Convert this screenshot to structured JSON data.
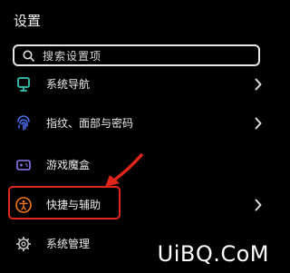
{
  "header": {
    "title": "设置"
  },
  "search": {
    "placeholder": "搜索设置项"
  },
  "settings_items": [
    {
      "label": "系统导航",
      "icon": "navigation-icon"
    },
    {
      "label": "指纹、面部与密码",
      "icon": "fingerprint-icon"
    },
    {
      "label": "游戏魔盒",
      "icon": "game-box-icon"
    },
    {
      "label": "快捷与辅助",
      "icon": "accessibility-icon"
    },
    {
      "label": "系统管理",
      "icon": "gear-icon"
    }
  ],
  "watermark": {
    "text": "UiBQ.CoM"
  },
  "colors": {
    "background": "#000000",
    "highlight": "#e0251b",
    "icon_teal": "#2fb4a8",
    "icon_blue": "#4b6ff0",
    "icon_purple": "#8a7bf0",
    "icon_orange": "#f27a1d"
  }
}
